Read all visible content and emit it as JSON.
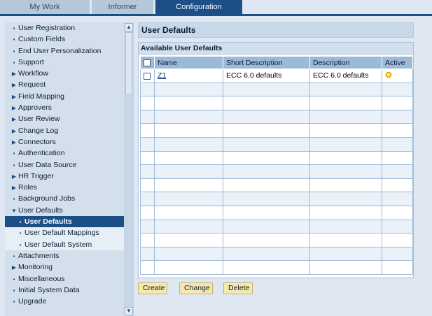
{
  "tabs": [
    {
      "label": "My Work",
      "active": false
    },
    {
      "label": "Informer",
      "active": false
    },
    {
      "label": "Configuration",
      "active": true
    }
  ],
  "sidebar": {
    "items": [
      {
        "label": "User Registration",
        "marker": "bullet",
        "level": 0
      },
      {
        "label": "Custom Fields",
        "marker": "bullet",
        "level": 0
      },
      {
        "label": "End User Personalization",
        "marker": "bullet",
        "level": 0
      },
      {
        "label": "Support",
        "marker": "bullet",
        "level": 0
      },
      {
        "label": "Workflow",
        "marker": "collapsed",
        "level": 0
      },
      {
        "label": "Request",
        "marker": "collapsed",
        "level": 0
      },
      {
        "label": "Field Mapping",
        "marker": "collapsed",
        "level": 0
      },
      {
        "label": "Approvers",
        "marker": "collapsed",
        "level": 0
      },
      {
        "label": "User Review",
        "marker": "collapsed",
        "level": 0
      },
      {
        "label": "Change Log",
        "marker": "collapsed",
        "level": 0
      },
      {
        "label": "Connectors",
        "marker": "collapsed",
        "level": 0
      },
      {
        "label": "Authentication",
        "marker": "bullet",
        "level": 0
      },
      {
        "label": "User Data Source",
        "marker": "bullet",
        "level": 0
      },
      {
        "label": "HR Trigger",
        "marker": "collapsed",
        "level": 0
      },
      {
        "label": "Roles",
        "marker": "collapsed",
        "level": 0
      },
      {
        "label": "Background Jobs",
        "marker": "bullet",
        "level": 0
      },
      {
        "label": "User Defaults",
        "marker": "expanded",
        "level": 0
      },
      {
        "label": "User Defaults",
        "marker": "bullet",
        "level": 1,
        "selected": true
      },
      {
        "label": "User Default Mappings",
        "marker": "bullet",
        "level": 1
      },
      {
        "label": "User Default System",
        "marker": "bullet",
        "level": 1
      },
      {
        "label": "Attachments",
        "marker": "bullet",
        "level": 0
      },
      {
        "label": "Monitoring",
        "marker": "collapsed",
        "level": 0
      },
      {
        "label": "Miscellaneous",
        "marker": "bullet",
        "level": 0
      },
      {
        "label": "Initial System Data",
        "marker": "bullet",
        "level": 0
      },
      {
        "label": "Upgrade",
        "marker": "bullet",
        "level": 0
      }
    ]
  },
  "main": {
    "title": "User Defaults",
    "panel_title": "Available User Defaults",
    "columns": [
      "Name",
      "Short Description",
      "Description",
      "Active"
    ],
    "rows": [
      {
        "name": "Z1",
        "short_description": "ECC 6.0 defaults",
        "description": "ECC 6.0 defaults",
        "active": true
      }
    ],
    "empty_rows": 14,
    "buttons": {
      "create": "Create",
      "change": "Change",
      "delete": "Delete"
    }
  },
  "colors": {
    "accent": "#1b4f86",
    "header": "#9cb9d8",
    "button": "#f4e7b0"
  }
}
